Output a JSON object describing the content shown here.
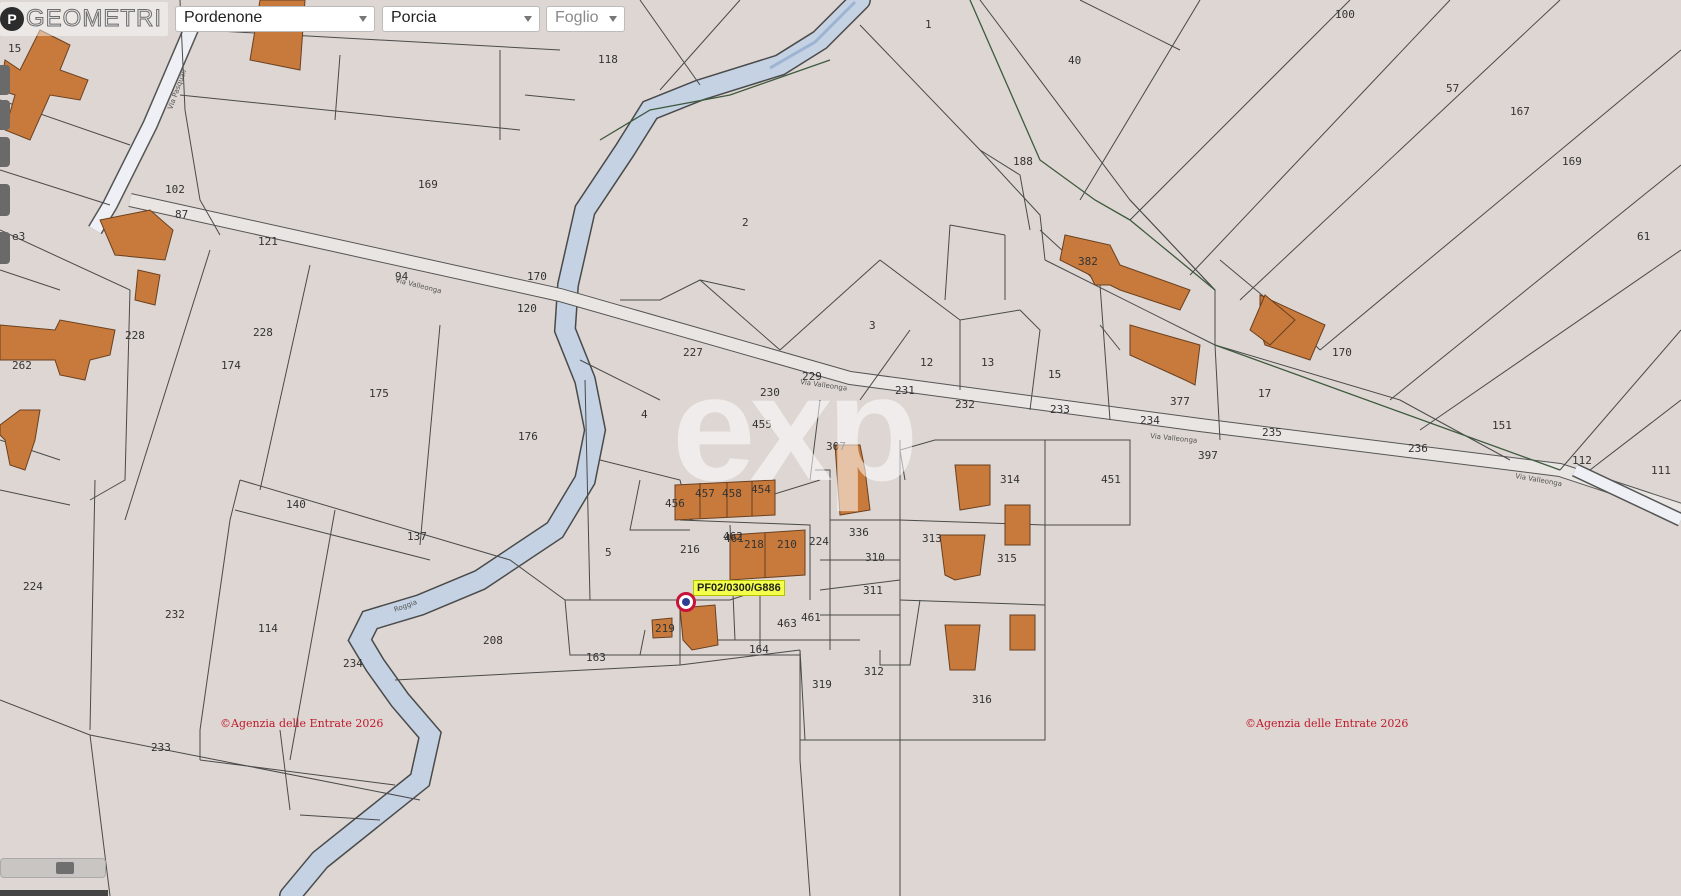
{
  "toolbar": {
    "logo_mark": "P",
    "logo_text": "GEOMETRI",
    "province_select": "Pordenone",
    "comune_select": "Porcia",
    "foglio_select": "Foglio"
  },
  "map": {
    "parcel_labels": [
      "1",
      "100",
      "40",
      "57",
      "167",
      "169",
      "61",
      "118",
      "15",
      "102",
      "87",
      "121",
      "94",
      "170",
      "120",
      "169",
      "227",
      "228",
      "2",
      "188",
      "382",
      "170",
      "377",
      "17",
      "151",
      "236",
      "112",
      "111",
      "3",
      "12",
      "13",
      "15",
      "233",
      "234",
      "235",
      "397",
      "229",
      "230",
      "231",
      "232",
      "455",
      "4",
      "456",
      "457",
      "458",
      "454",
      "307",
      "336",
      "313",
      "310",
      "311",
      "461",
      "218",
      "210",
      "224",
      "216",
      "5",
      "315",
      "314",
      "451",
      "462",
      "463",
      "461",
      "208",
      "219",
      "163",
      "164",
      "319",
      "312",
      "316",
      "174",
      "175",
      "176",
      "140",
      "137",
      "224",
      "232",
      "114",
      "234",
      "233",
      "228",
      "262",
      "e3"
    ],
    "road_labels": [
      "Via Pasquali",
      "Via Valleonga",
      "Via Valleonga",
      "Via Valleonga",
      "Via Valleonga",
      "Roggia"
    ],
    "copyright_1": "©Agenzia delle Entrate 2026",
    "copyright_2": "©Agenzia delle Entrate 2026",
    "watermark": "exp",
    "parcel_tag": "PF02/0300/G886"
  },
  "colors": {
    "background": "#ddd6d2",
    "parcel_line": "#4a4a4a",
    "building": "#c77a3c",
    "river": "#c4d2e3",
    "copyright": "#c0182a",
    "tag": "#f3ff4a"
  }
}
